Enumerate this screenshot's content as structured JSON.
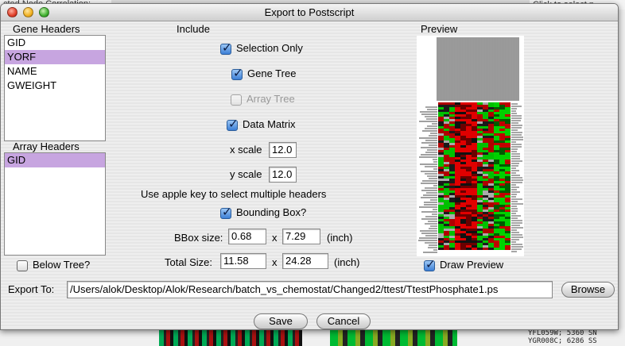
{
  "background": {
    "top_left_text": "cted Node Correlation:",
    "top_right_text": "Click to select n",
    "bottom_right_line1": "YFL059W; 5360 SN",
    "bottom_right_line2": "YGR008C; 6286 SS"
  },
  "window": {
    "title": "Export to Postscript"
  },
  "gene_headers": {
    "label": "Gene Headers",
    "items": [
      {
        "label": "GID",
        "selected": false
      },
      {
        "label": "YORF",
        "selected": true
      },
      {
        "label": "NAME",
        "selected": false
      },
      {
        "label": "GWEIGHT",
        "selected": false
      }
    ]
  },
  "array_headers": {
    "label": "Array Headers",
    "items": [
      {
        "label": "GID",
        "selected": true
      }
    ]
  },
  "below_tree": {
    "label": "Below Tree?",
    "checked": false
  },
  "include": {
    "label": "Include",
    "selection_only": {
      "label": "Selection Only",
      "checked": true
    },
    "gene_tree": {
      "label": "Gene Tree",
      "checked": true
    },
    "array_tree": {
      "label": "Array Tree",
      "checked": false,
      "enabled": false
    },
    "data_matrix": {
      "label": "Data Matrix",
      "checked": true
    },
    "x_scale": {
      "label": "x scale",
      "value": "12.0"
    },
    "y_scale": {
      "label": "y scale",
      "value": "12.0"
    },
    "hint": "Use apple key to select multiple headers",
    "bounding_box": {
      "label": "Bounding Box?",
      "checked": true
    },
    "bbox_size": {
      "label": "BBox size:",
      "w": "0.68",
      "x": "x",
      "h": "7.29",
      "unit": "(inch)"
    },
    "total_size": {
      "label": "Total Size:",
      "w": "11.58",
      "x": "x",
      "h": "24.28",
      "unit": "(inch)"
    }
  },
  "preview": {
    "label": "Preview",
    "draw_preview": {
      "label": "Draw Preview",
      "checked": true
    }
  },
  "export_to": {
    "label": "Export To:",
    "value": "/Users/alok/Desktop/Alok/Research/batch_vs_chemostat/Changed2/ttest/TtestPhosphate1.ps",
    "browse_label": "Browse"
  },
  "buttons": {
    "save": "Save",
    "cancel": "Cancel"
  },
  "colors": {
    "selection": "#c7a5e0",
    "heatmap_red": "#e00000",
    "heatmap_green": "#00d000",
    "checkbox_blue": "#3c7fd6"
  }
}
